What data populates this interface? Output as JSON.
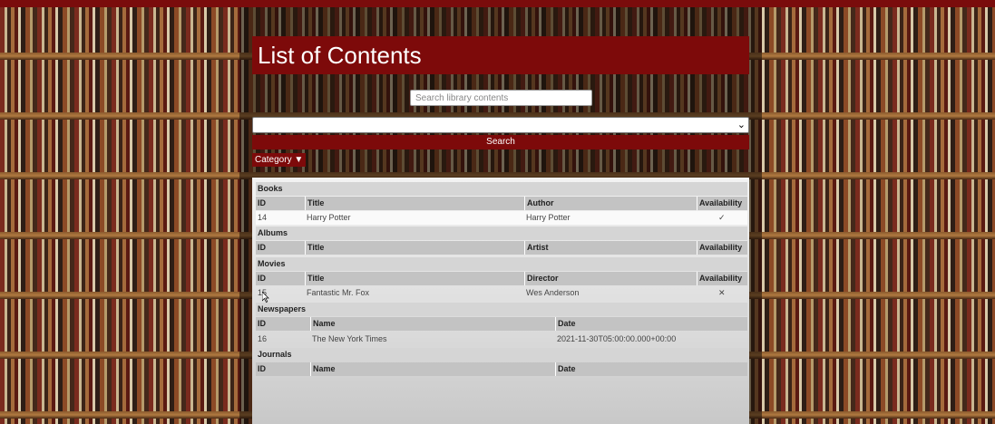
{
  "header": {
    "title": "List of Contents"
  },
  "search": {
    "placeholder": "Search library contents",
    "button_label": "Search"
  },
  "filter": {
    "category_label": "Category ▼",
    "select_value": ""
  },
  "sections": {
    "books": {
      "title": "Books",
      "columns": [
        "ID",
        "Title",
        "Author",
        "Availability"
      ],
      "rows": [
        {
          "id": "14",
          "title": "Harry Potter",
          "author": "Harry Potter",
          "availability": "✓"
        }
      ]
    },
    "albums": {
      "title": "Albums",
      "columns": [
        "ID",
        "Title",
        "Artist",
        "Availability"
      ]
    },
    "movies": {
      "title": "Movies",
      "columns": [
        "ID",
        "Title",
        "Director",
        "Availability"
      ],
      "rows": [
        {
          "id": "15",
          "title": "Fantastic Mr. Fox",
          "director": "Wes Anderson",
          "availability": "✕"
        }
      ]
    },
    "newspapers": {
      "title": "Newspapers",
      "columns": [
        "ID",
        "Name",
        "Date"
      ],
      "rows": [
        {
          "id": "16",
          "name": "The New York Times",
          "date": "2021-11-30T05:00:00.000+00:00"
        }
      ]
    },
    "journals": {
      "title": "Journals",
      "columns": [
        "ID",
        "Name",
        "Date"
      ]
    }
  },
  "colors": {
    "accent": "#7d0a0a",
    "panel": "#e6e6e6"
  }
}
